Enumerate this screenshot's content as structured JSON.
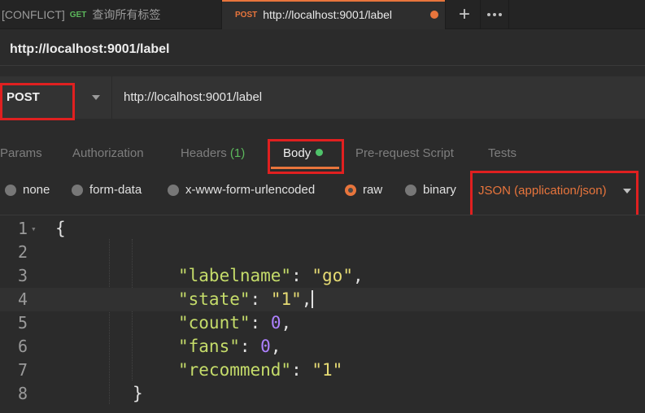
{
  "tabs": [
    {
      "prefix": "[CONFLICT]",
      "method": "GET",
      "title": "查询所有标签",
      "active": false
    },
    {
      "method": "POST",
      "title": "http://localhost:9001/label",
      "active": true,
      "unsaved": true
    }
  ],
  "tab_actions": {
    "add_label": "+",
    "more_icon": "ellipsis-icon"
  },
  "request": {
    "title": "http://localhost:9001/label",
    "method": "POST",
    "url": "http://localhost:9001/label"
  },
  "request_tabs": [
    {
      "label": "Params"
    },
    {
      "label": "Authorization"
    },
    {
      "label": "Headers",
      "count": "(1)"
    },
    {
      "label": "Body",
      "active": true
    },
    {
      "label": "Pre-request Script"
    },
    {
      "label": "Tests"
    }
  ],
  "body_types": [
    {
      "label": "none",
      "selected": false
    },
    {
      "label": "form-data",
      "selected": false
    },
    {
      "label": "x-www-form-urlencoded",
      "selected": false
    },
    {
      "label": "raw",
      "selected": true
    },
    {
      "label": "binary",
      "selected": false
    }
  ],
  "content_type": "JSON (application/json)",
  "editor": {
    "line_numbers": [
      "1",
      "2",
      "3",
      "4",
      "5",
      "6",
      "7",
      "8"
    ],
    "json_pairs": [
      {
        "key": "\"labelname\"",
        "value": "\"go\"",
        "comma": ","
      },
      {
        "key": "\"state\"",
        "value": "\"1\"",
        "comma": ","
      },
      {
        "key": "\"count\"",
        "value": "0",
        "comma": ","
      },
      {
        "key": "\"fans\"",
        "value": "0",
        "comma": ","
      },
      {
        "key": "\"recommend\"",
        "value": "\"1\"",
        "comma": ""
      }
    ],
    "open_brace": "{",
    "close_brace": "}",
    "colon": ":"
  },
  "colors": {
    "accent": "#e8753c",
    "get_method": "#5cb85c",
    "highlight_box": "#e02020",
    "json_key": "#c5dc6a",
    "json_string": "#e6db74",
    "json_number": "#ae81ff"
  }
}
